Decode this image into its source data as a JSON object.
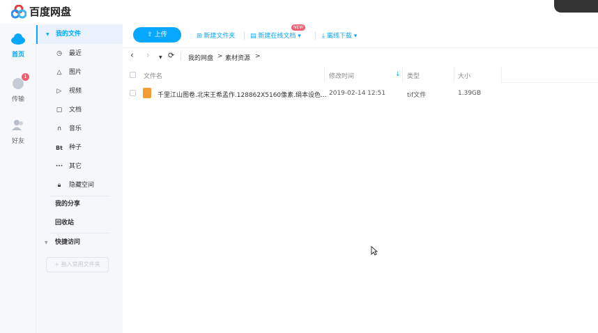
{
  "app": {
    "title": "百度网盘"
  },
  "nav": [
    {
      "label": "首页"
    },
    {
      "label": "传输",
      "badge": "1"
    },
    {
      "label": "好友"
    }
  ],
  "sidebar": {
    "my_files": "我的文件",
    "items": [
      {
        "label": "最近",
        "icon": "clock-icon"
      },
      {
        "label": "图片",
        "icon": "image-icon"
      },
      {
        "label": "视频",
        "icon": "video-icon"
      },
      {
        "label": "文档",
        "icon": "document-icon"
      },
      {
        "label": "音乐",
        "icon": "headphones-icon"
      },
      {
        "label": "种子",
        "icon": "bt-icon"
      },
      {
        "label": "其它",
        "icon": "more-icon"
      },
      {
        "label": "隐藏空间",
        "icon": "lock-icon"
      }
    ],
    "my_share": "我的分享",
    "recycle": "回收站",
    "quick_access": "快捷访问",
    "insert_folder": "+ 拖入常用文件夹",
    "bt_glyph": "Bt",
    "more_glyph": "···"
  },
  "toolbar": {
    "upload": "上传",
    "new_folder": "新建文件夹",
    "new_online_doc": "新建在线文档",
    "new_badge": "NEW",
    "offline_download": "离线下载"
  },
  "breadcrumb": [
    "我的网盘",
    "素材资源"
  ],
  "table": {
    "headers": {
      "name": "文件名",
      "modified": "修改时间",
      "type": "类型",
      "size": "大小"
    },
    "rows": [
      {
        "name": "千里江山图卷.北宋王希孟作.128862X5160像素.绢本设色...",
        "modified": "2019-02-14 12:51",
        "type": "tif文件",
        "size": "1.39GB"
      }
    ]
  },
  "colors": {
    "accent": "#06a7ff",
    "badge": "#f25b70",
    "file_icon": "#f39c33"
  }
}
